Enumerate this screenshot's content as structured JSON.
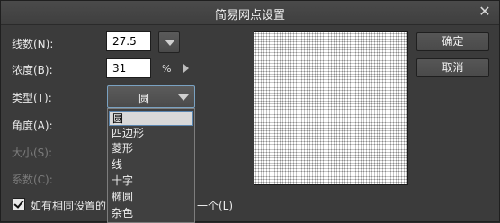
{
  "dialog": {
    "title": "简易网点设置",
    "close_glyph": "✕"
  },
  "form": {
    "lines_label": "线数(N):",
    "lines_value": "27.5",
    "density_label": "浓度(B):",
    "density_value": "31",
    "density_unit": "%",
    "type_label": "类型(T):",
    "type_value": "圆",
    "angle_label": "角度(A):",
    "size_label": "大小(S):",
    "coef_label": "系数(C):"
  },
  "dropdown": {
    "options": [
      "圆",
      "四边形",
      "菱形",
      "线",
      "十字",
      "椭圆",
      "杂色"
    ],
    "selected_index": 0
  },
  "buttons": {
    "ok": "确定",
    "cancel": "取消"
  },
  "checkbox": {
    "checked": true,
    "label_left": "如有相同设置的",
    "label_right": "一个(L)"
  },
  "icons": {
    "lines_stepper": "chevron-down-icon",
    "density_arrow": "right-arrow-icon",
    "type_select": "chevron-down-icon",
    "close": "close-icon"
  }
}
